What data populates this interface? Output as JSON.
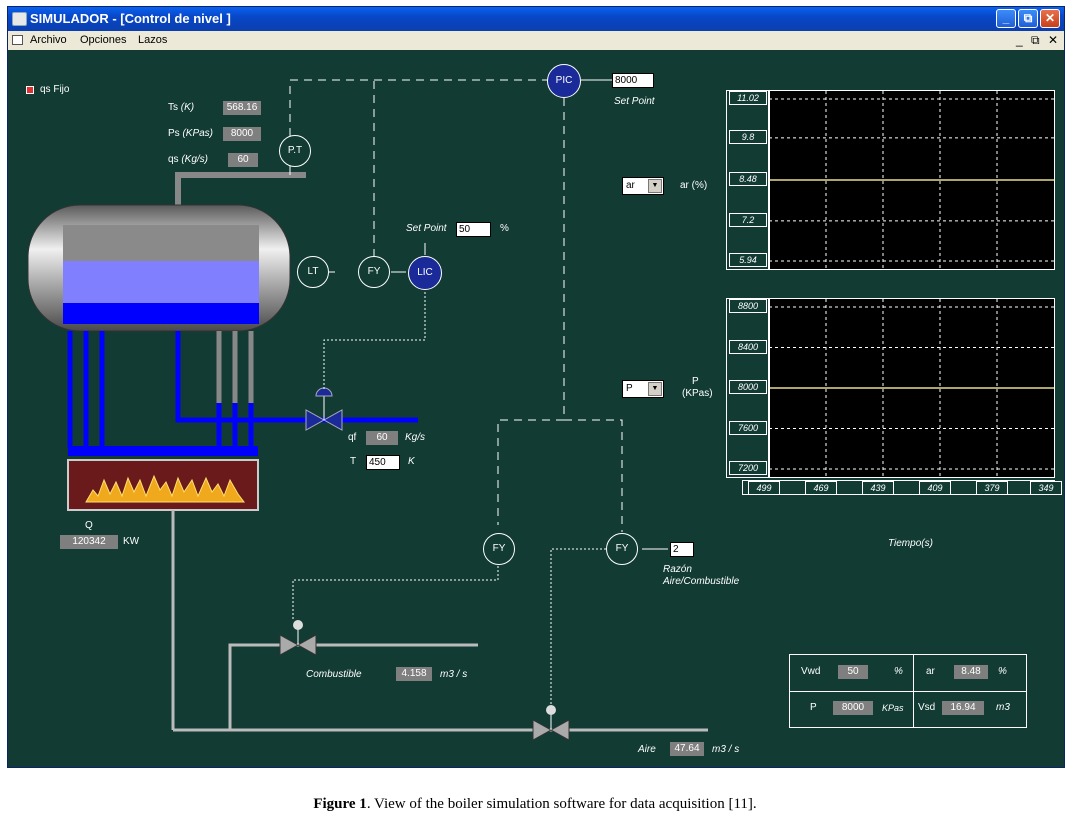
{
  "window": {
    "title": "SIMULADOR - [Control de nivel ]",
    "minimize": "_",
    "restore": "⧉",
    "close": "✕"
  },
  "menu": {
    "items": [
      "Archivo",
      "Opciones",
      "Lazos"
    ],
    "mdi_min": "_",
    "mdi_restore": "⧉",
    "mdi_close": "✕"
  },
  "qs_fijo": {
    "label": "qs Fijo"
  },
  "steam": {
    "ts_label": "Ts",
    "ts_unit": "(K)",
    "ts_value": "568.16",
    "ps_label": "Ps",
    "ps_unit": "(KPas)",
    "ps_value": "8000",
    "qs_label": "qs",
    "qs_unit": "(Kg/s)",
    "qs_value": "60"
  },
  "instruments": {
    "pt": "P.T",
    "pic": "PIC",
    "lt": "LT",
    "fy1": "FY",
    "lic": "LIC",
    "fy2": "FY",
    "fy3": "FY"
  },
  "pressure_sp": {
    "value": "8000",
    "label": "Set Point"
  },
  "level_sp": {
    "label": "Set Point",
    "value": "50",
    "unit": "%"
  },
  "feed": {
    "qf_label": "qf",
    "qf_value": "60",
    "qf_unit": "Kg/s",
    "t_label": "T",
    "t_value": "450",
    "t_unit": "K"
  },
  "heat": {
    "q_label": "Q",
    "q_value": "120342",
    "q_unit": "KW"
  },
  "ratio": {
    "value": "2",
    "label1": "Razón",
    "label2": "Aire/Combustible"
  },
  "fuel": {
    "label": "Combustible",
    "value": "4.158",
    "unit": "m3 / s"
  },
  "air": {
    "label": "Aire",
    "value": "47.64",
    "unit": "m3 / s"
  },
  "chart_top": {
    "select_value": "ar",
    "ylabel": "ar (%)",
    "yticks": [
      "11.02",
      "9.8",
      "8.48",
      "7.2",
      "5.94"
    ]
  },
  "chart_bottom": {
    "select_value": "P",
    "ylabel1": "P",
    "ylabel2": "(KPas)",
    "yticks": [
      "8800",
      "8400",
      "8000",
      "7600",
      "7200"
    ],
    "xticks": [
      "499",
      "469",
      "439",
      "409",
      "379",
      "349"
    ],
    "xlabel": "Tiempo(s)"
  },
  "chart_data": [
    {
      "type": "line",
      "title": "",
      "ylabel": "ar (%)",
      "xlabel": "",
      "yticks": [
        11.02,
        9.8,
        8.48,
        7.2,
        5.94
      ],
      "ylim": [
        5.94,
        11.02
      ],
      "grid": true,
      "series": [
        {
          "values": [
            8.48,
            8.48
          ],
          "x": [
            499,
            349
          ]
        }
      ],
      "line_color": "#e8dc8c"
    },
    {
      "type": "line",
      "title": "",
      "ylabel": "P (KPas)",
      "xlabel": "Tiempo(s)",
      "yticks": [
        8800,
        8400,
        8000,
        7600,
        7200
      ],
      "xticks": [
        499,
        469,
        439,
        409,
        379,
        349
      ],
      "ylim": [
        7200,
        8800
      ],
      "grid": true,
      "series": [
        {
          "values": [
            8000,
            8000
          ],
          "x": [
            499,
            349
          ]
        }
      ],
      "line_color": "#e8dc8c"
    }
  ],
  "table": {
    "vwd_label": "Vwd",
    "vwd_value": "50",
    "vwd_unit": "%",
    "ar_label": "ar",
    "ar_value": "8.48",
    "ar_unit": "%",
    "p_label": "P",
    "p_value": "8000",
    "p_unit": "KPas",
    "vsd_label": "Vsd",
    "vsd_value": "16.94",
    "vsd_unit": "m3"
  },
  "caption": {
    "bold": "Figure 1",
    "text": ". View of the boiler simulation software for data acquisition [11]."
  },
  "colors": {
    "background": "#123b34",
    "water": "#0000ff",
    "instrument_blue": "#1a2a98",
    "trend_line": "#e8dc8c"
  }
}
